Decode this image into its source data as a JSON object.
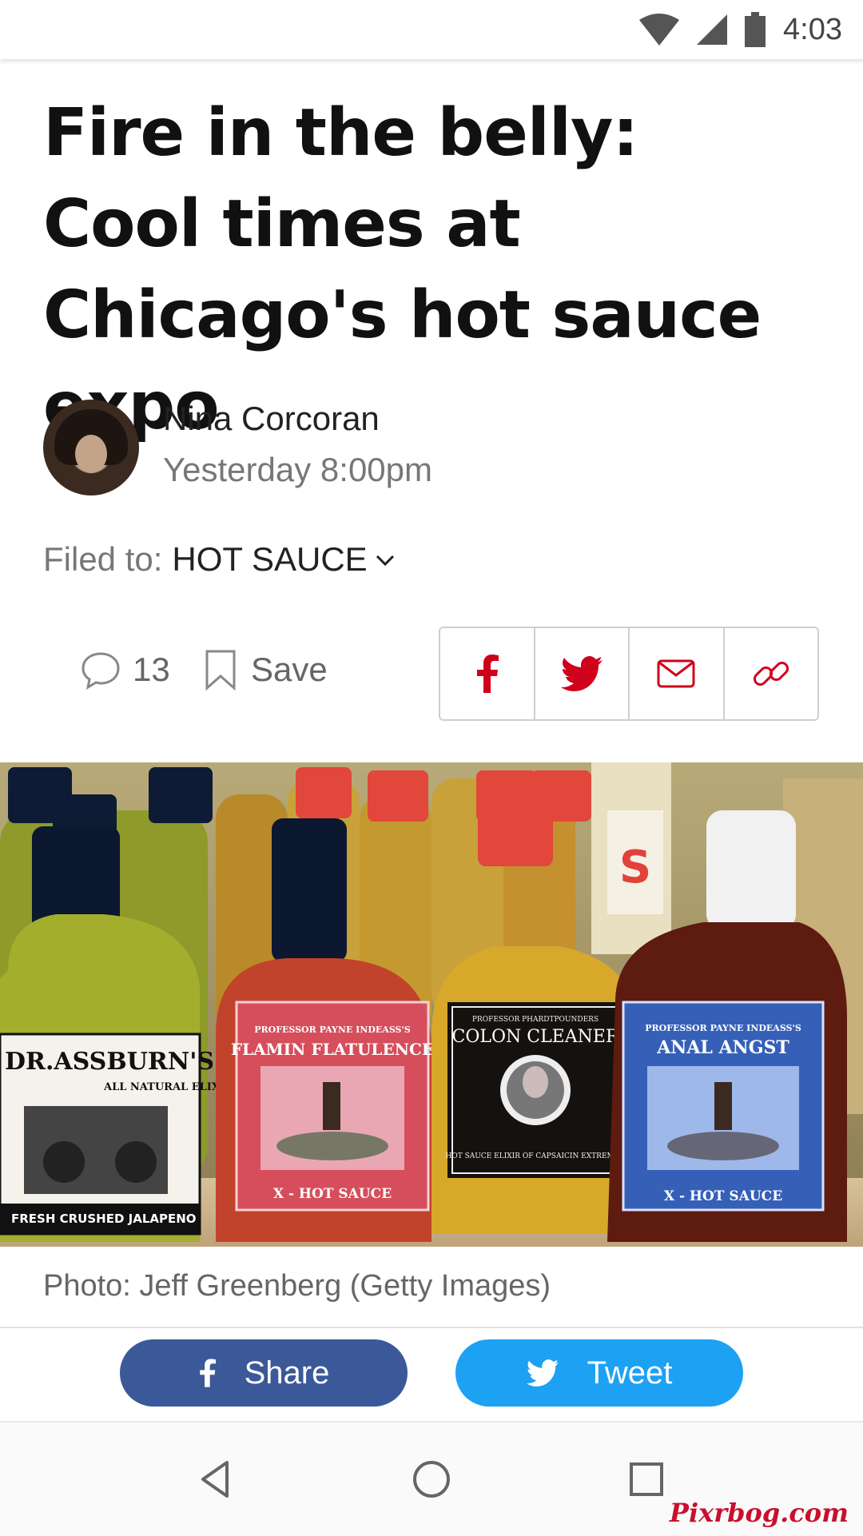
{
  "status_bar": {
    "time": "4:03"
  },
  "article": {
    "headline": "Fire in the belly: Cool times at Chicago's hot sauce expo",
    "author": "Nina Corcoran",
    "date": "Yesterday 8:00pm",
    "filed_label": "Filed to:",
    "filed_tag": "HOT SAUCE",
    "comment_count": "13",
    "save_label": "Save",
    "photo_caption": "Photo: Jeff Greenberg (Getty Images)"
  },
  "photo_labels": {
    "bottle1_brand": "DR.ASSBURN'S",
    "bottle1_sub": "ALL NATURAL ELIXIRS",
    "bottle1_flavor": "FRESH CRUSHED JALAPENO",
    "bottle2_maker": "PROFESSOR PAYNE INDEASS'S",
    "bottle2_name": "FLAMIN FLATULENCE",
    "bottle2_type": "X - HOT SAUCE",
    "bottle3_maker": "PROFESSOR PHARDTPOUNDERS",
    "bottle3_name": "COLON CLEANER",
    "bottle3_type": "HOT SAUCE ELIXIR OF CAPSAICIN EXTREMUS",
    "bottle4_maker": "PROFESSOR PAYNE INDEASS'S",
    "bottle4_name": "ANAL ANGST",
    "bottle4_type": "X - HOT SAUCE"
  },
  "share_bar": {
    "facebook_label": "Share",
    "twitter_label": "Tweet"
  },
  "watermark": "Pixrbog.com",
  "colors": {
    "facebook": "#3b5998",
    "twitter": "#1da1f2",
    "share_icon_red": "#d0021b"
  },
  "icons": [
    "wifi-icon",
    "cell-signal-icon",
    "battery-icon",
    "comment-icon",
    "bookmark-icon",
    "facebook-icon",
    "twitter-icon",
    "mail-icon",
    "link-icon",
    "back-icon",
    "home-icon",
    "recents-icon"
  ]
}
